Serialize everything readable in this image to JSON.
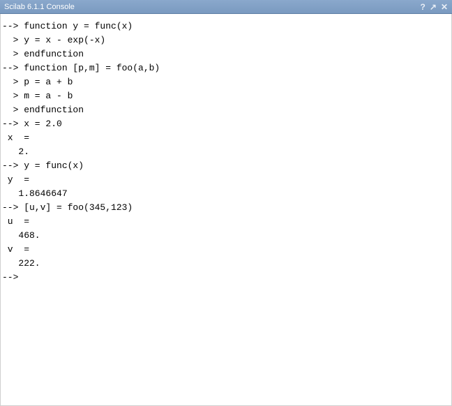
{
  "titlebar": {
    "title": "Scilab 6.1.1 Console",
    "help_icon": "?",
    "undock_icon": "↗",
    "close_icon": "✕"
  },
  "console": {
    "lines": [
      "",
      "--> function y = func(x)",
      "  > y = x - exp(-x)",
      "  > endfunction",
      "",
      "--> function [p,m] = foo(a,b)",
      "  > p = a + b",
      "  > m = a - b",
      "  > endfunction",
      "",
      "--> x = 2.0",
      " x  = ",
      "",
      "   2.",
      "",
      "--> y = func(x)",
      " y  = ",
      "",
      "   1.8646647",
      "",
      "--> [u,v] = foo(345,123)",
      " u  = ",
      "",
      "   468.",
      " v  = ",
      "",
      "   222.",
      "",
      "--> "
    ]
  }
}
